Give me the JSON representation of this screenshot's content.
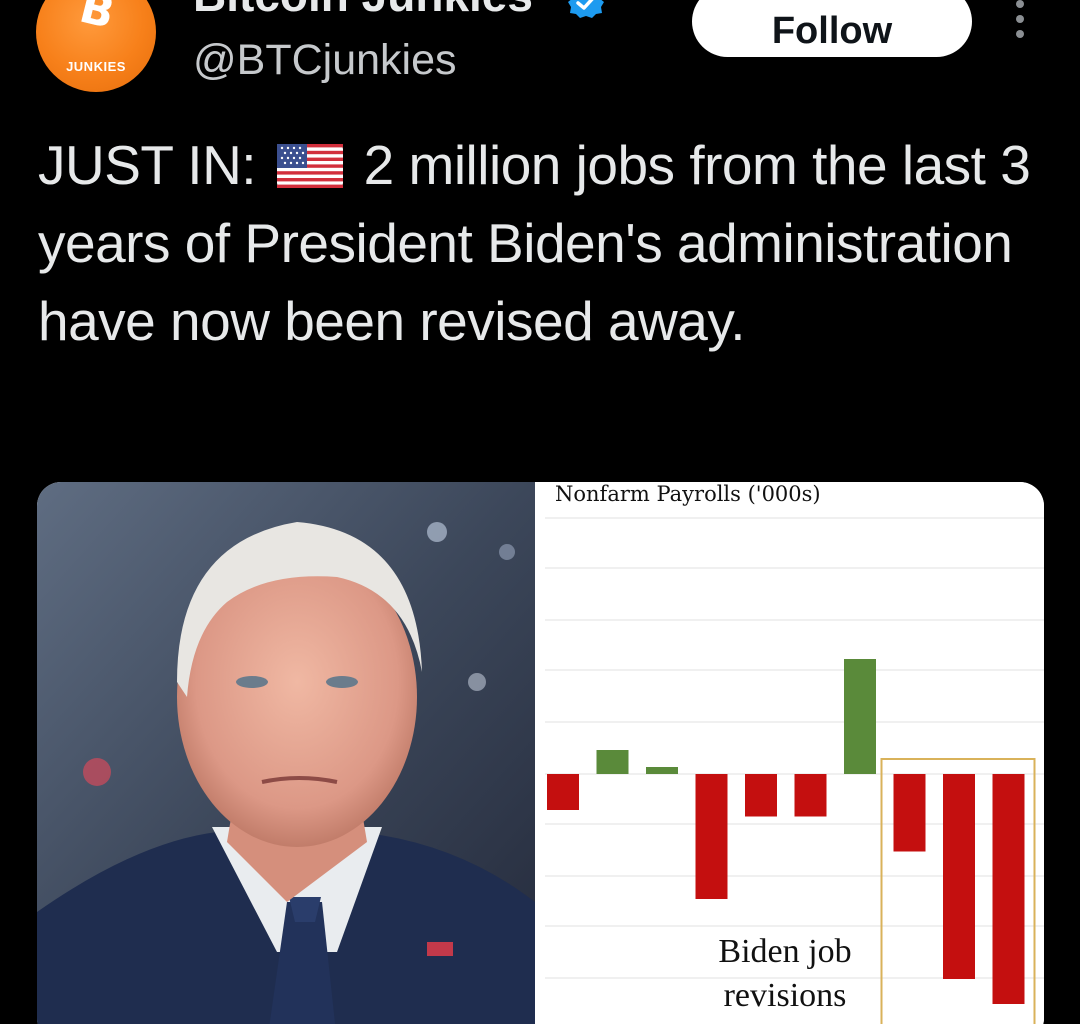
{
  "header": {
    "display_name": "Bitcoin Junkies",
    "handle": "@BTCjunkies",
    "avatar_brand_text": "JUNKIES",
    "avatar_symbol": "B",
    "follow_label": "Follow",
    "verified_icon": "verified-badge-icon",
    "more_icon": "more-options-icon"
  },
  "tweet": {
    "prefix": "JUST IN:",
    "flag_icon": "us-flag-emoji",
    "body": "2 million jobs from the last 3 years of President Biden's administration have now been revised away."
  },
  "media": {
    "photo_alt": "Portrait of President Biden"
  },
  "chart_data": {
    "type": "bar",
    "title": "Nonfarm Payrolls ('000s)",
    "annotation": "Biden job revisions",
    "values": [
      -72,
      48,
      14,
      -250,
      -85,
      -85,
      230,
      -155,
      -410,
      -460
    ],
    "colors": {
      "positive": "#5a8a3a",
      "negative": "#c40f0f",
      "highlight_box": "#d9b25a"
    },
    "highlighted_range": [
      7,
      9
    ],
    "grid": true
  }
}
